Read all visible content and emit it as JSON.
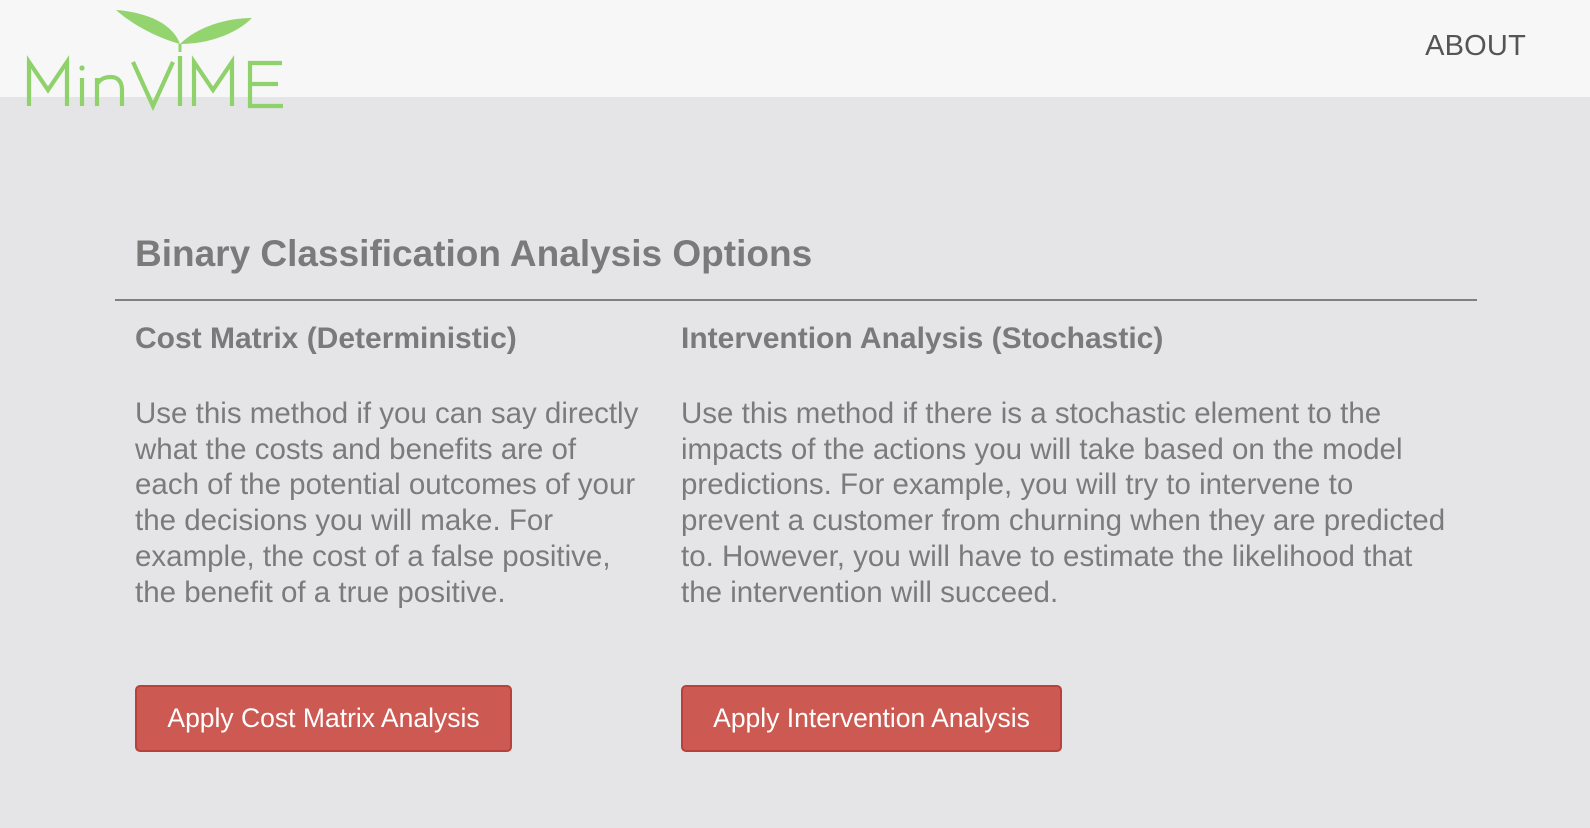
{
  "header": {
    "logo_text": "MinVIME",
    "nav": {
      "about_label": "ABOUT"
    }
  },
  "main": {
    "title": "Binary Classification Analysis Options",
    "options": [
      {
        "heading": "Cost Matrix (Deterministic)",
        "description": "Use this method if you can say directly what the costs and benefits are of each of the potential outcomes of your the decisions you will make. For example, the cost of a false positive, the benefit of a true positive.",
        "button_label": "Apply Cost Matrix Analysis"
      },
      {
        "heading": "Intervention Analysis (Stochastic)",
        "description": "Use this method if there is a stochastic element to the impacts of the actions you will take based on the model predictions. For example, you will try to intervene to prevent a customer from churning when they are predicted to. However, you will have to estimate the likelihood that the intervention will succeed.",
        "button_label": "Apply Intervention Analysis"
      }
    ]
  },
  "colors": {
    "logo_green": "#8fd16a",
    "button_red": "#cd5a52",
    "background": "#e5e5e8",
    "header_background": "#f7f7f7"
  }
}
